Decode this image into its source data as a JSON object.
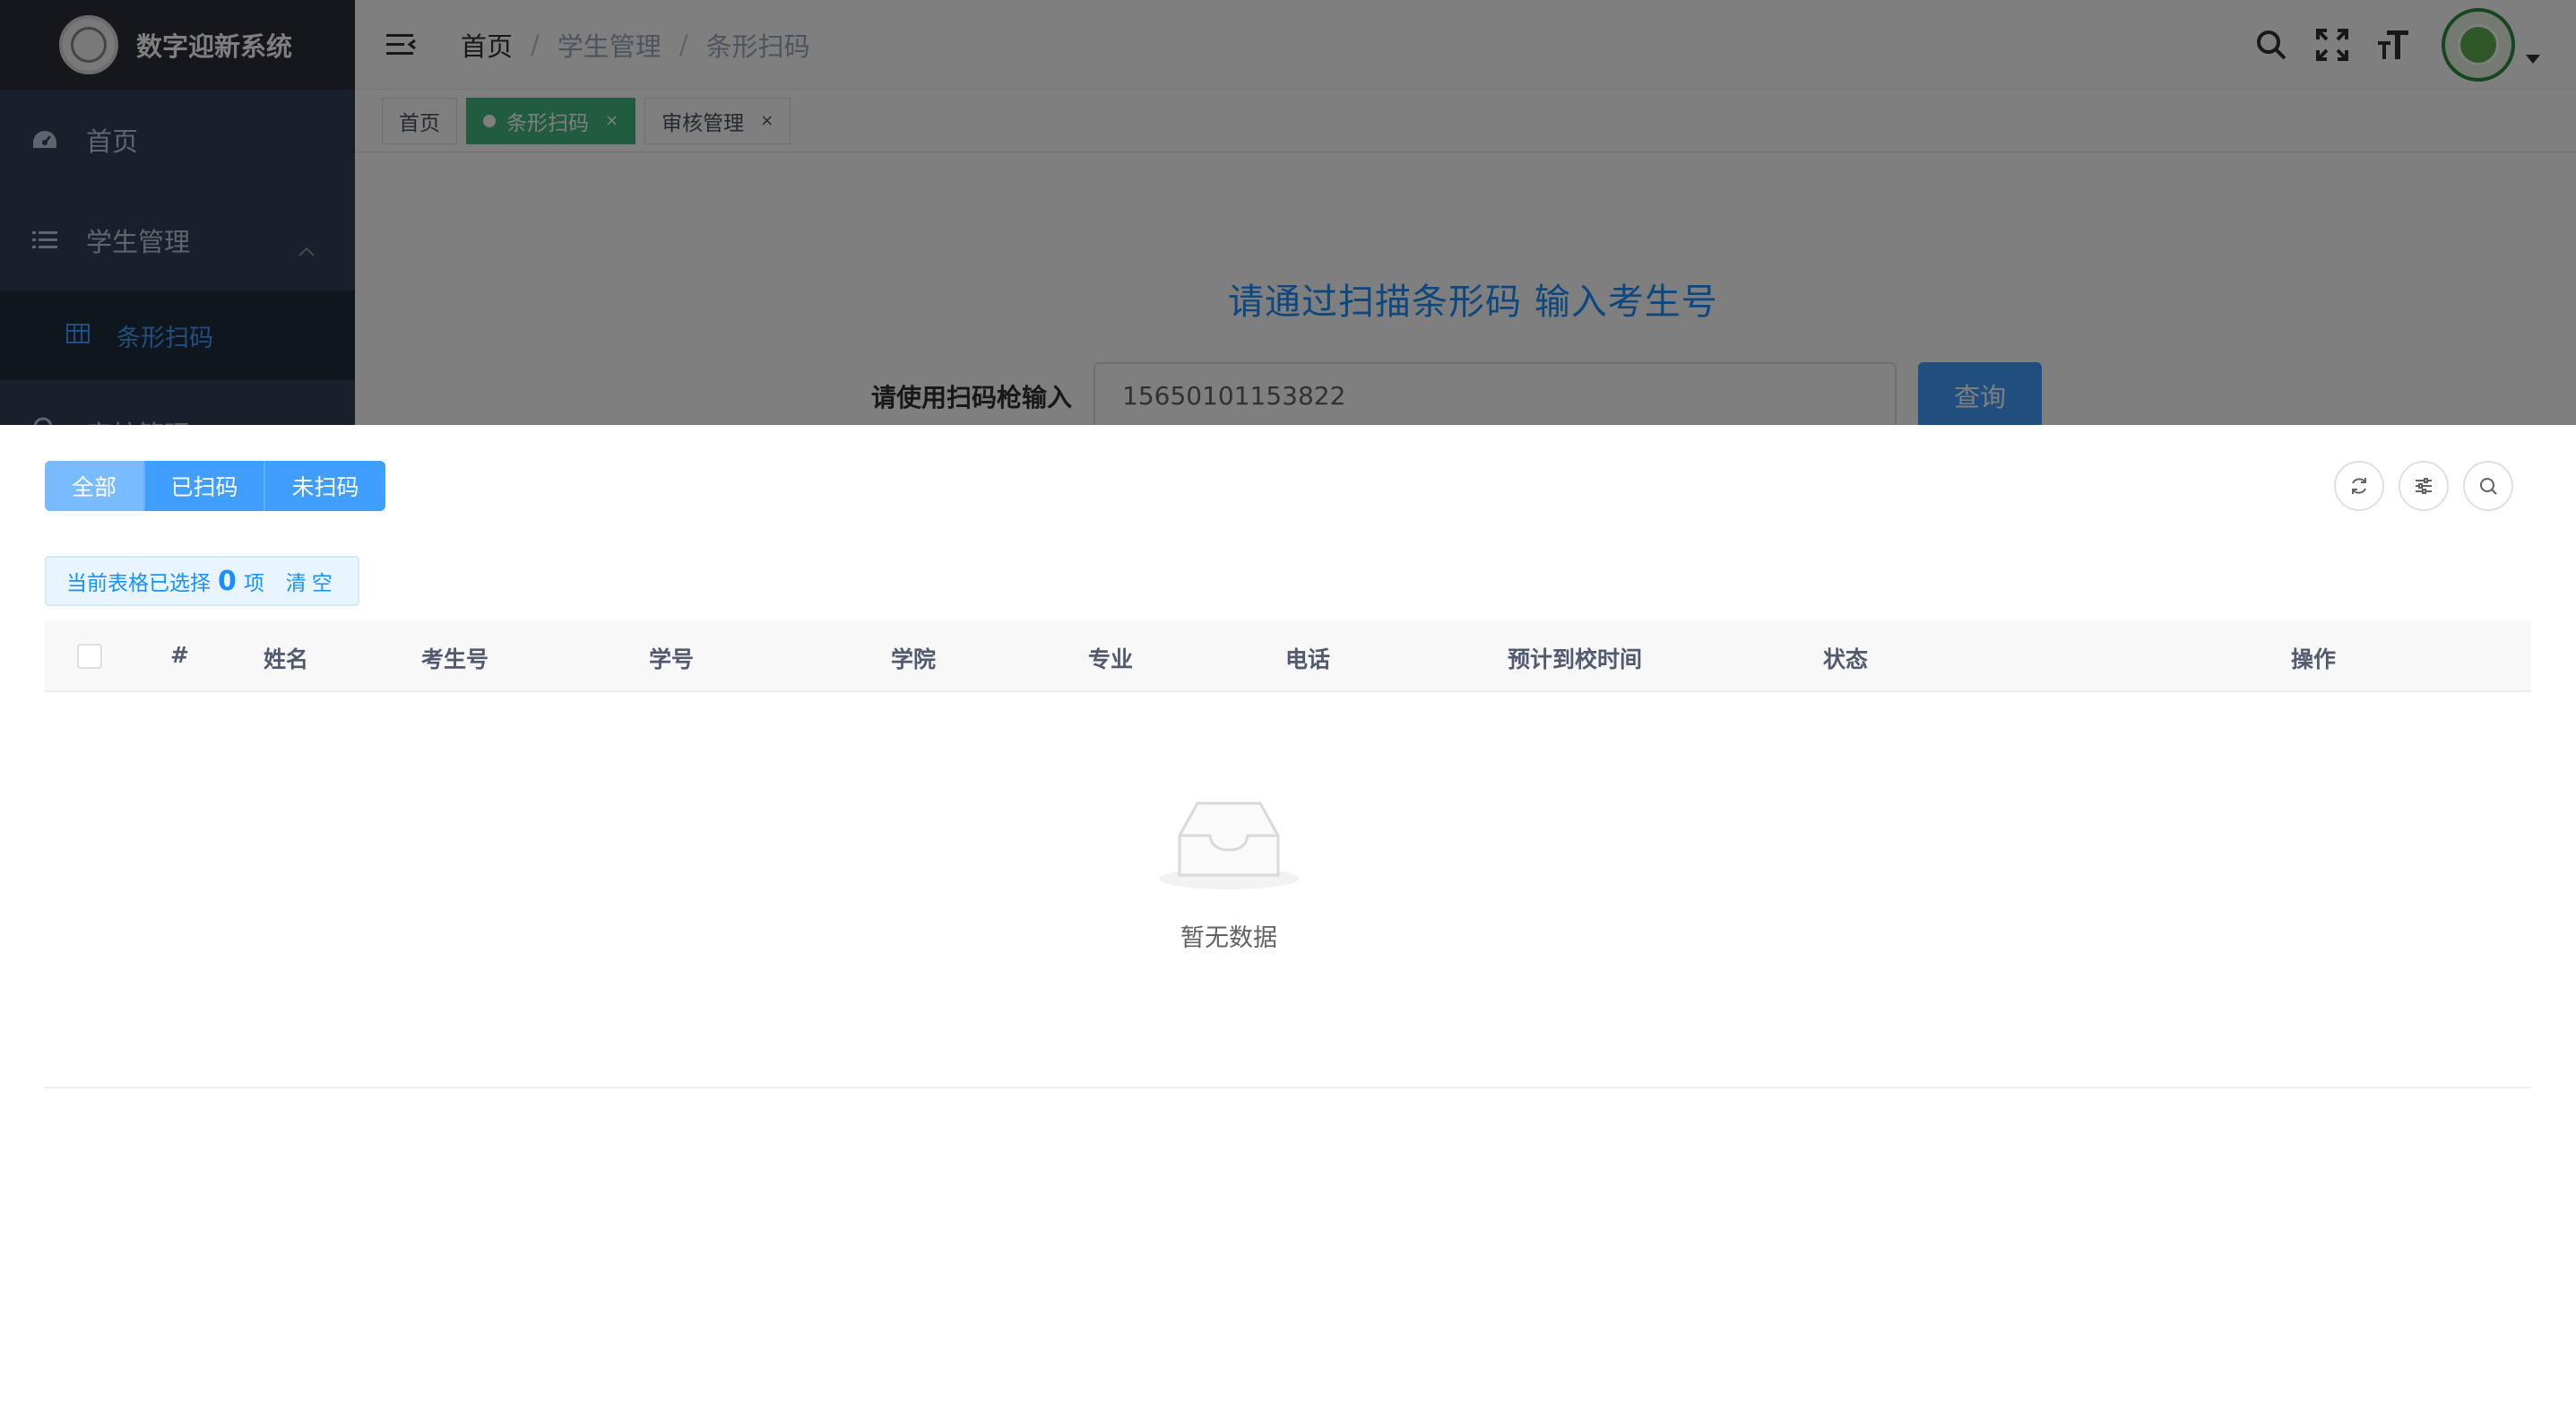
{
  "app": {
    "title": "数字迎新系统"
  },
  "sidebar": {
    "items": [
      {
        "label": "首页",
        "icon": "dashboard-icon"
      },
      {
        "label": "学生管理",
        "icon": "list-icon"
      },
      {
        "label": "条形扫码",
        "icon": "table-icon"
      },
      {
        "label": "审核管理",
        "icon": "search-icon"
      }
    ]
  },
  "navbar": {
    "breadcrumb": [
      "首页",
      "学生管理",
      "条形扫码"
    ],
    "separator": "/"
  },
  "tags": [
    {
      "label": "首页"
    },
    {
      "label": "条形扫码",
      "close": "×"
    },
    {
      "label": "审核管理",
      "close": "×"
    }
  ],
  "scan": {
    "title": "请通过扫描条形码 输入考生号",
    "input_label": "请使用扫码枪输入",
    "input_value": "15650101153822",
    "button_label": "查询"
  },
  "filters": [
    "全部",
    "已扫码",
    "未扫码"
  ],
  "selection": {
    "prefix": "当前表格已选择",
    "count": "0",
    "suffix": "项",
    "clear": "清空"
  },
  "table": {
    "columns": [
      "#",
      "姓名",
      "考生号",
      "学号",
      "学院",
      "专业",
      "电话",
      "预计到校时间",
      "状态",
      "操作"
    ],
    "empty_text": "暂无数据"
  },
  "colors": {
    "sidebar_bg": "#304156",
    "primary": "#409eff",
    "active_tag": "#42b983"
  }
}
